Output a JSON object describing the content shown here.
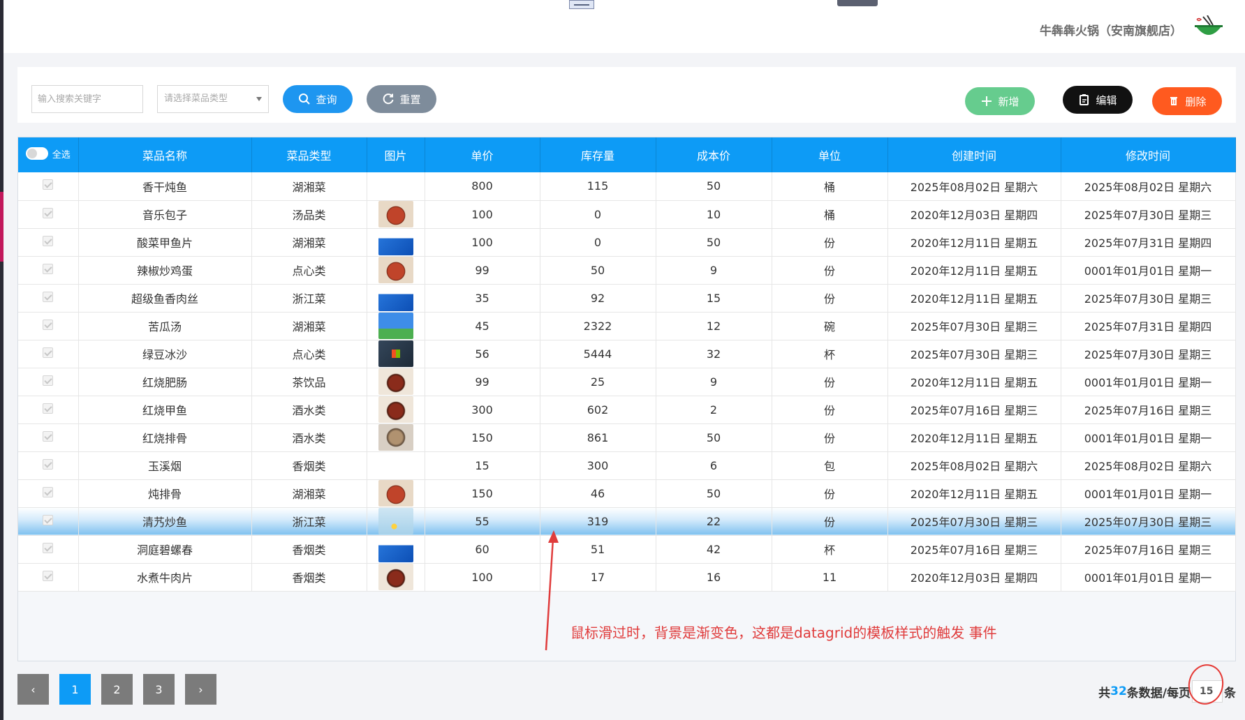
{
  "header": {
    "shop_name": "牛犇犇火锅（安南旗舰店）"
  },
  "toolbar": {
    "search_placeholder": "输入搜索关键字",
    "type_placeholder": "请选择菜品类型",
    "query_label": "查询",
    "reset_label": "重置",
    "add_label": "新增",
    "edit_label": "编辑",
    "delete_label": "删除"
  },
  "table": {
    "select_all_label": "全选",
    "columns": [
      "菜品名称",
      "菜品类型",
      "图片",
      "单价",
      "库存量",
      "成本价",
      "单位",
      "创建时间",
      "修改时间"
    ],
    "rows": [
      {
        "name": "香干炖鱼",
        "type": "湖湘菜",
        "image": "none",
        "price": "800",
        "stock": "115",
        "cost": "50",
        "unit": "桶",
        "created": "2025年08月02日 星期六",
        "modified": "2025年08月02日 星期六"
      },
      {
        "name": "音乐包子",
        "type": "汤品类",
        "image": "food1",
        "price": "100",
        "stock": "0",
        "cost": "10",
        "unit": "桶",
        "created": "2020年12月03日 星期四",
        "modified": "2025年07月30日 星期三"
      },
      {
        "name": "酸菜甲鱼片",
        "type": "湖湘菜",
        "image": "box",
        "price": "100",
        "stock": "0",
        "cost": "50",
        "unit": "份",
        "created": "2020年12月11日 星期五",
        "modified": "2025年07月31日 星期四"
      },
      {
        "name": "辣椒炒鸡蛋",
        "type": "点心类",
        "image": "food1",
        "price": "99",
        "stock": "50",
        "cost": "9",
        "unit": "份",
        "created": "2020年12月11日 星期五",
        "modified": "0001年01月01日 星期一"
      },
      {
        "name": "超级鱼香肉丝",
        "type": "浙江菜",
        "image": "box",
        "price": "35",
        "stock": "92",
        "cost": "15",
        "unit": "份",
        "created": "2020年12月11日 星期五",
        "modified": "2025年07月30日 星期三"
      },
      {
        "name": "苦瓜汤",
        "type": "湖湘菜",
        "image": "sky",
        "price": "45",
        "stock": "2322",
        "cost": "12",
        "unit": "碗",
        "created": "2025年07月30日 星期三",
        "modified": "2025年07月31日 星期四"
      },
      {
        "name": "绿豆冰沙",
        "type": "点心类",
        "image": "win",
        "price": "56",
        "stock": "5444",
        "cost": "32",
        "unit": "杯",
        "created": "2025年07月30日 星期三",
        "modified": "2025年07月30日 星期三"
      },
      {
        "name": "红烧肥肠",
        "type": "茶饮品",
        "image": "food2",
        "price": "99",
        "stock": "25",
        "cost": "9",
        "unit": "份",
        "created": "2020年12月11日 星期五",
        "modified": "0001年01月01日 星期一"
      },
      {
        "name": "红烧甲鱼",
        "type": "酒水类",
        "image": "food2",
        "price": "300",
        "stock": "602",
        "cost": "2",
        "unit": "份",
        "created": "2025年07月16日 星期三",
        "modified": "2025年07月16日 星期三"
      },
      {
        "name": "红烧排骨",
        "type": "酒水类",
        "image": "food3",
        "price": "150",
        "stock": "861",
        "cost": "50",
        "unit": "份",
        "created": "2020年12月11日 星期五",
        "modified": "0001年01月01日 星期一"
      },
      {
        "name": "玉溪烟",
        "type": "香烟类",
        "image": "none",
        "price": "15",
        "stock": "300",
        "cost": "6",
        "unit": "包",
        "created": "2025年08月02日 星期六",
        "modified": "2025年08月02日 星期六"
      },
      {
        "name": "炖排骨",
        "type": "湖湘菜",
        "image": "food1",
        "price": "150",
        "stock": "46",
        "cost": "50",
        "unit": "份",
        "created": "2020年12月11日 星期五",
        "modified": "0001年01月01日 星期一"
      },
      {
        "name": "清艿炒鱼",
        "type": "浙江菜",
        "image": "flower",
        "price": "55",
        "stock": "319",
        "cost": "22",
        "unit": "份",
        "created": "2025年07月30日 星期三",
        "modified": "2025年07月30日 星期三",
        "hover": true
      },
      {
        "name": "洞庭碧螺春",
        "type": "香烟类",
        "image": "box",
        "price": "60",
        "stock": "51",
        "cost": "42",
        "unit": "杯",
        "created": "2025年07月16日 星期三",
        "modified": "2025年07月16日 星期三"
      },
      {
        "name": "水煮牛肉片",
        "type": "香烟类",
        "image": "food2",
        "price": "100",
        "stock": "17",
        "cost": "16",
        "unit": "11",
        "created": "2020年12月03日 星期四",
        "modified": "0001年01月01日 星期一"
      }
    ]
  },
  "annotation": {
    "text": "鼠标滑过时，背景是渐变色，这都是datagrid的模板样式的触发 事件"
  },
  "pager": {
    "prev": "‹",
    "pages": [
      "1",
      "2",
      "3"
    ],
    "next": "›",
    "active_page": "1",
    "info_prefix": "共",
    "total": "32",
    "info_middle": "条数据/每页",
    "page_size": "15",
    "info_suffix": "条"
  },
  "colors": {
    "primary": "#0d9bf6",
    "add": "#66cc8e",
    "edit": "#111111",
    "delete": "#ff5a1f",
    "reset": "#7e8c9b",
    "annotation": "#e03c3c"
  }
}
